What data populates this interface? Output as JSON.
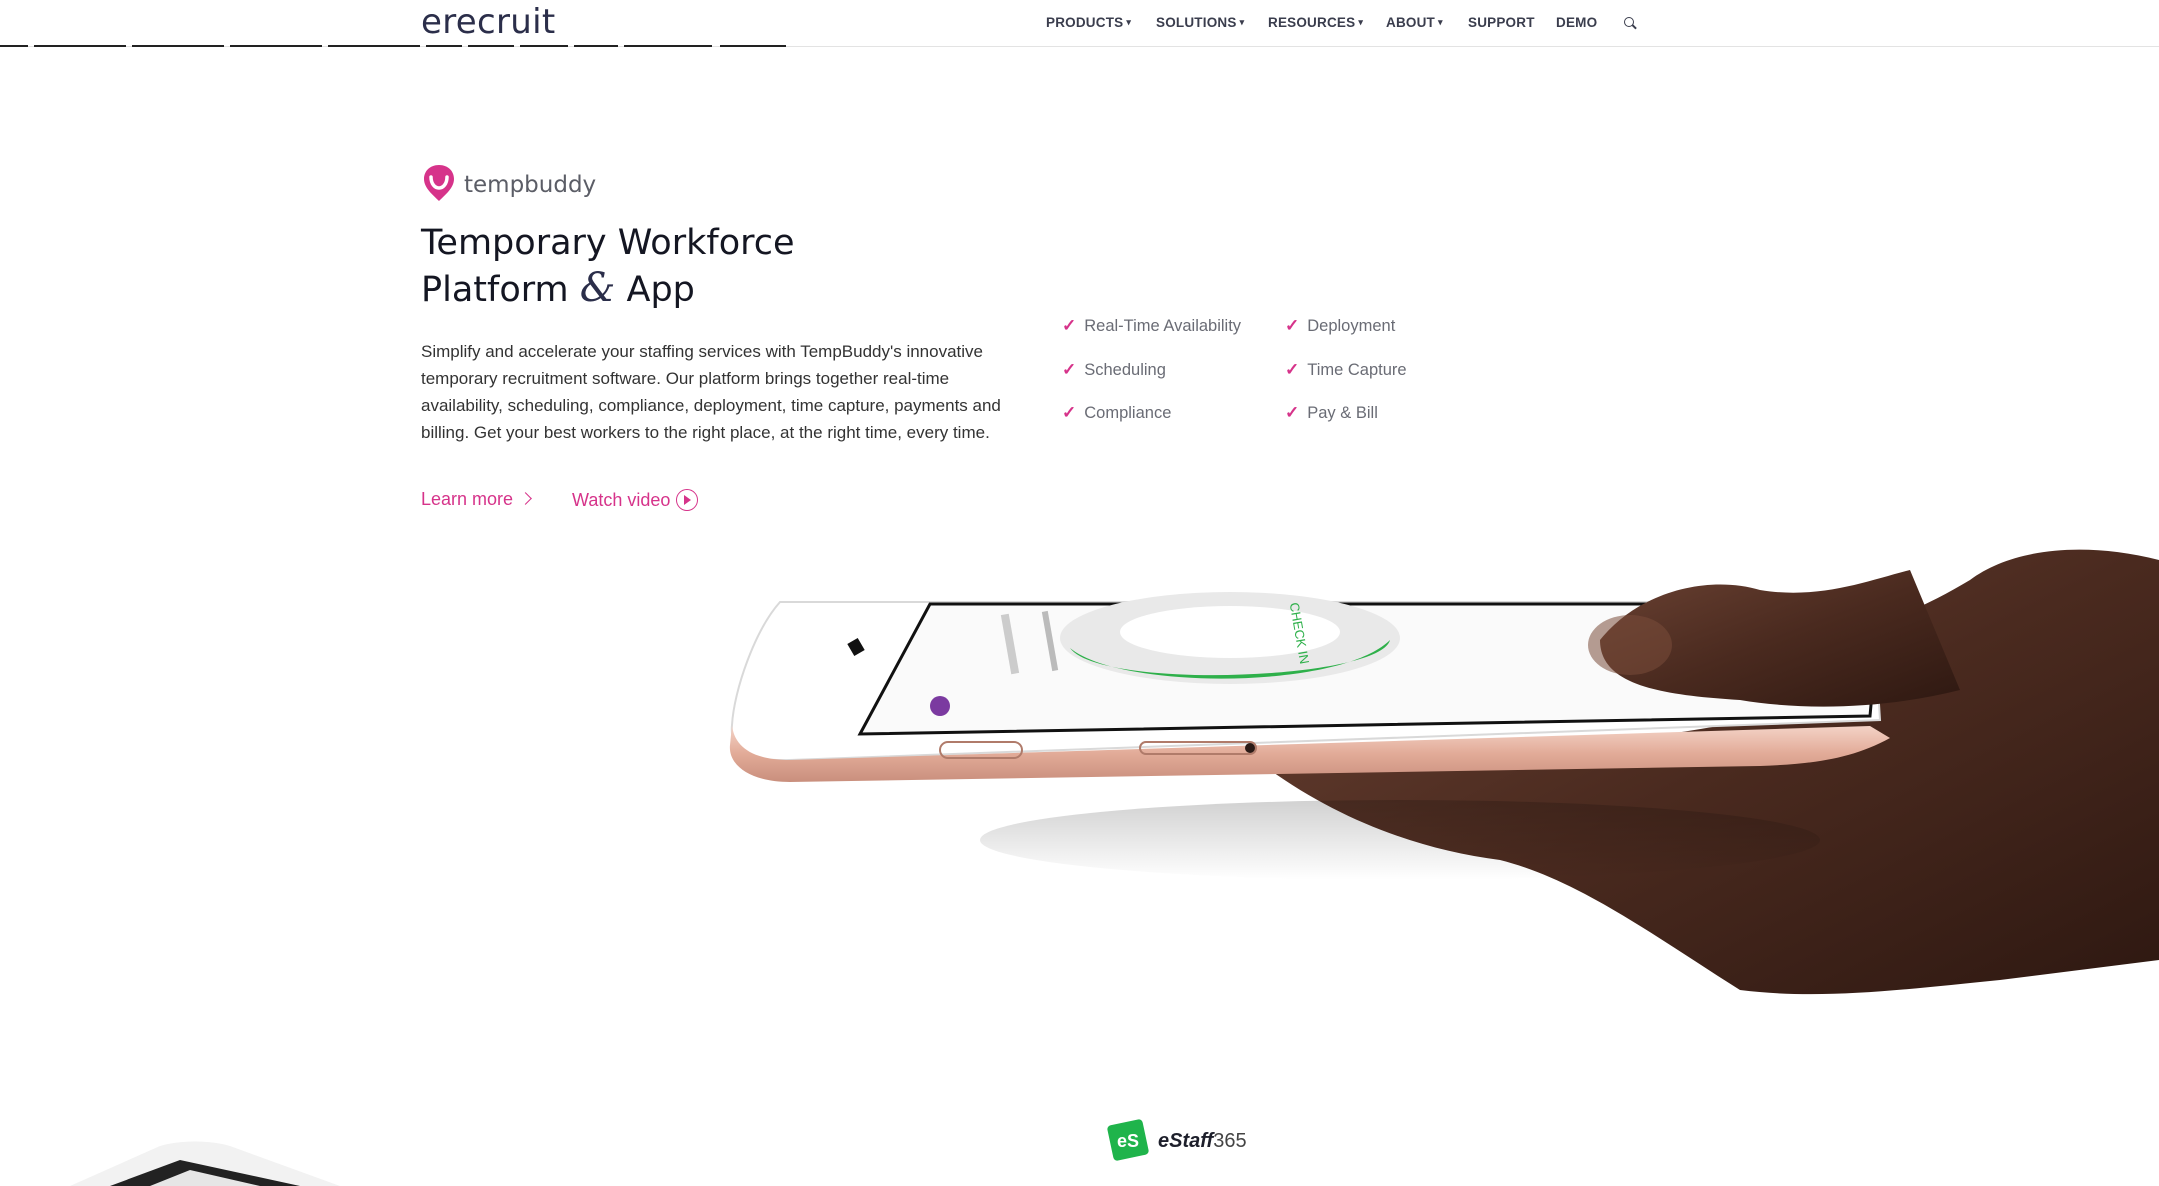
{
  "header": {
    "logo": "erecruit",
    "nav": [
      {
        "label": "PRODUCTS",
        "dropdown": true
      },
      {
        "label": "SOLUTIONS",
        "dropdown": true
      },
      {
        "label": "RESOURCES",
        "dropdown": true
      },
      {
        "label": "ABOUT",
        "dropdown": true
      },
      {
        "label": "SUPPORT",
        "dropdown": false
      },
      {
        "label": "DEMO",
        "dropdown": false
      }
    ],
    "search_icon": "search-icon"
  },
  "tempbuddy": {
    "brand": "tempbuddy",
    "headline_line1": "Temporary Workforce",
    "headline_platform": "Platform",
    "headline_amp": "&",
    "headline_app": "App",
    "description": "Simplify and accelerate your staffing services with TempBuddy's innovative temporary recruitment software. Our platform brings together real-time availability, scheduling, compliance, deployment, time capture, payments and billing. Get your best workers to the right place, at the right time, every time.",
    "learn_more": "Learn more",
    "watch_video": "Watch video",
    "features": [
      "Real-Time Availability",
      "Scheduling",
      "Compliance",
      "Deployment",
      "Time Capture",
      "Pay & Bill"
    ]
  },
  "phone_screen": {
    "checkin_label": "CHECK IN"
  },
  "estaff": {
    "name": "eStaff",
    "number": "365",
    "badge_text": "eS"
  },
  "colors": {
    "accent": "#d6338a",
    "navy": "#2b2e4a",
    "estaff_green": "#1fb44b",
    "phone_rose_gold": "#e8b8a8",
    "progress_green": "#2eb04a"
  }
}
